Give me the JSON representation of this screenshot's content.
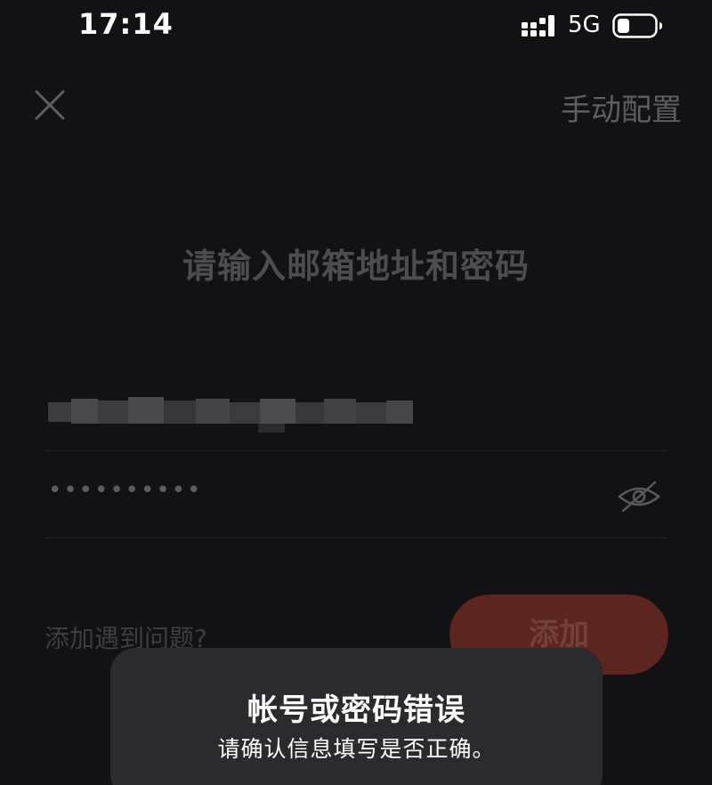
{
  "status_bar": {
    "time": "17:14",
    "network": "5G",
    "signal_icon": "cellular-signal-icon",
    "battery_icon": "battery-icon"
  },
  "nav": {
    "close_icon": "close-icon",
    "manual_config_label": "手动配置"
  },
  "title": "请输入邮箱地址和密码",
  "email_field": {
    "value_obscured": true
  },
  "password_field": {
    "value": "••••••••••",
    "visibility_icon": "eye-slash-icon"
  },
  "help_link": "添加遇到问题?",
  "add_button_label": "添加",
  "toast": {
    "title": "帐号或密码错误",
    "message": "请确认信息填写是否正确。"
  },
  "colors": {
    "background": "#121113",
    "accent": "#5c2520",
    "toast_background": "#2b2a2d"
  }
}
